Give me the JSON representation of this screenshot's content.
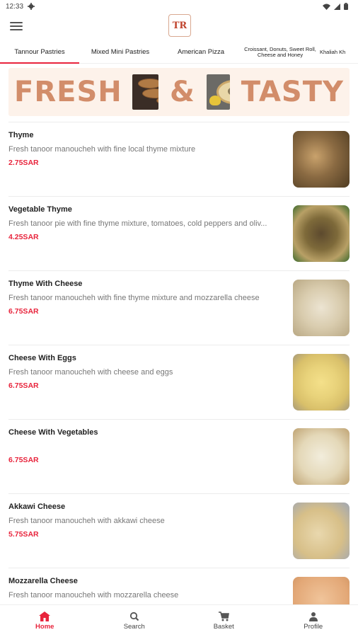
{
  "status_bar": {
    "time": "12:33"
  },
  "app": {
    "logo_text": "TR"
  },
  "tabs": [
    {
      "label": "Tannour Pastries",
      "active": true
    },
    {
      "label": "Mixed Mini Pastries",
      "active": false
    },
    {
      "label": "American Pizza",
      "active": false
    },
    {
      "label": "Croissant, Donuts, Sweet Roll, Cheese and Honey",
      "active": false
    },
    {
      "label": "Khaliah Kh",
      "active": false
    }
  ],
  "banner": {
    "word1": "FRESH",
    "word2": "&",
    "word3": "TASTY"
  },
  "menu_items": [
    {
      "name": "Thyme",
      "description": "Fresh tanoor manoucheh with fine local thyme mixture",
      "price": "2.75SAR"
    },
    {
      "name": "Vegetable Thyme",
      "description": "Fresh tanoor pie with fine thyme mixture, tomatoes, cold peppers and oliv...",
      "price": "4.25SAR"
    },
    {
      "name": "Thyme With Cheese",
      "description": "Fresh tanoor manoucheh with fine thyme mixture and mozzarella cheese",
      "price": "6.75SAR"
    },
    {
      "name": "Cheese With Eggs",
      "description": "Fresh tanoor manoucheh with cheese and eggs",
      "price": "6.75SAR"
    },
    {
      "name": "Cheese With Vegetables",
      "description": "",
      "price": "6.75SAR"
    },
    {
      "name": "Akkawi Cheese",
      "description": "Fresh tanoor manoucheh with akkawi cheese",
      "price": "5.75SAR"
    },
    {
      "name": "Mozzarella Cheese",
      "description": "Fresh tanoor manoucheh with mozzarella cheese",
      "price": ""
    }
  ],
  "bottom_nav": [
    {
      "label": "Home",
      "icon": "home-icon",
      "active": true
    },
    {
      "label": "Search",
      "icon": "search-icon",
      "active": false
    },
    {
      "label": "Basket",
      "icon": "cart-icon",
      "active": false
    },
    {
      "label": "Profile",
      "icon": "person-icon",
      "active": false
    }
  ],
  "colors": {
    "accent": "#e8243c",
    "banner_text": "#d28d6a",
    "banner_bg": "#fdf2ea"
  }
}
